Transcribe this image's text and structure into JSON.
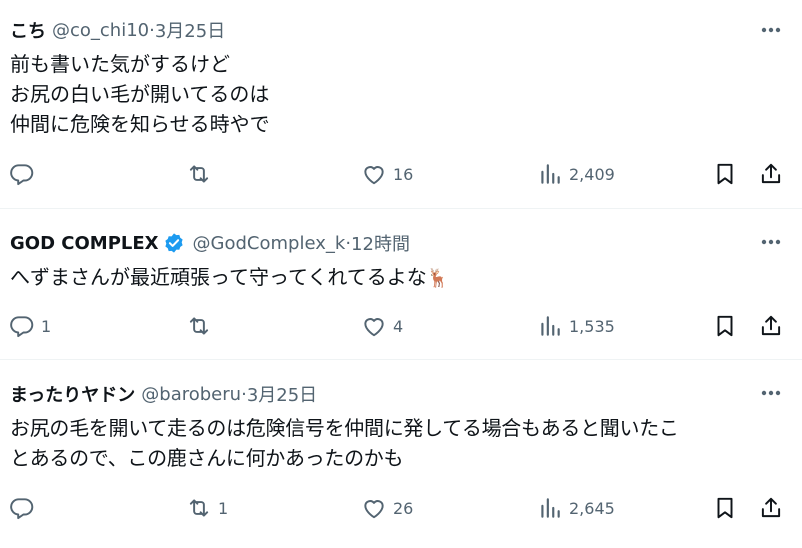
{
  "tweets": [
    {
      "name": "こち",
      "handle": "@co_chi10",
      "separator": " · ",
      "time": "3月25日",
      "lines": [
        "前も書いた気がするけど",
        "お尻の白い毛が開いてるのは",
        "仲間に危険を知らせる時やで"
      ],
      "reply_count": "",
      "retweet_count": "",
      "like_count": "16",
      "view_count": "2,409"
    },
    {
      "name": "GOD COMPLEX",
      "verified": true,
      "handle": "@GodComplex_k",
      "separator": " · ",
      "time": "12時間",
      "lines": [
        "へずまさんが最近頑張って守ってくれてるよな"
      ],
      "emoji": "🦌",
      "reply_count": "1",
      "retweet_count": "",
      "like_count": "4",
      "view_count": "1,535"
    },
    {
      "name": "まったりヤドン",
      "handle": "@baroberu",
      "separator": " · ",
      "time": "3月25日",
      "lines": [
        "お尻の毛を開いて走るのは危険信号を仲間に発してる場合もあると聞いたこ",
        "とあるので、この鹿さんに何かあったのかも"
      ],
      "reply_count": "",
      "retweet_count": "1",
      "like_count": "26",
      "view_count": "2,645"
    }
  ],
  "icons": [
    "reply-icon",
    "retweet-icon",
    "like-icon",
    "views-icon",
    "bookmark-icon",
    "share-icon",
    "more-icon",
    "verified-badge-icon"
  ],
  "colors": {
    "text": "#0f1419",
    "secondary": "#536471",
    "verified": "#1d9bf0",
    "divider": "#eff3f4"
  }
}
